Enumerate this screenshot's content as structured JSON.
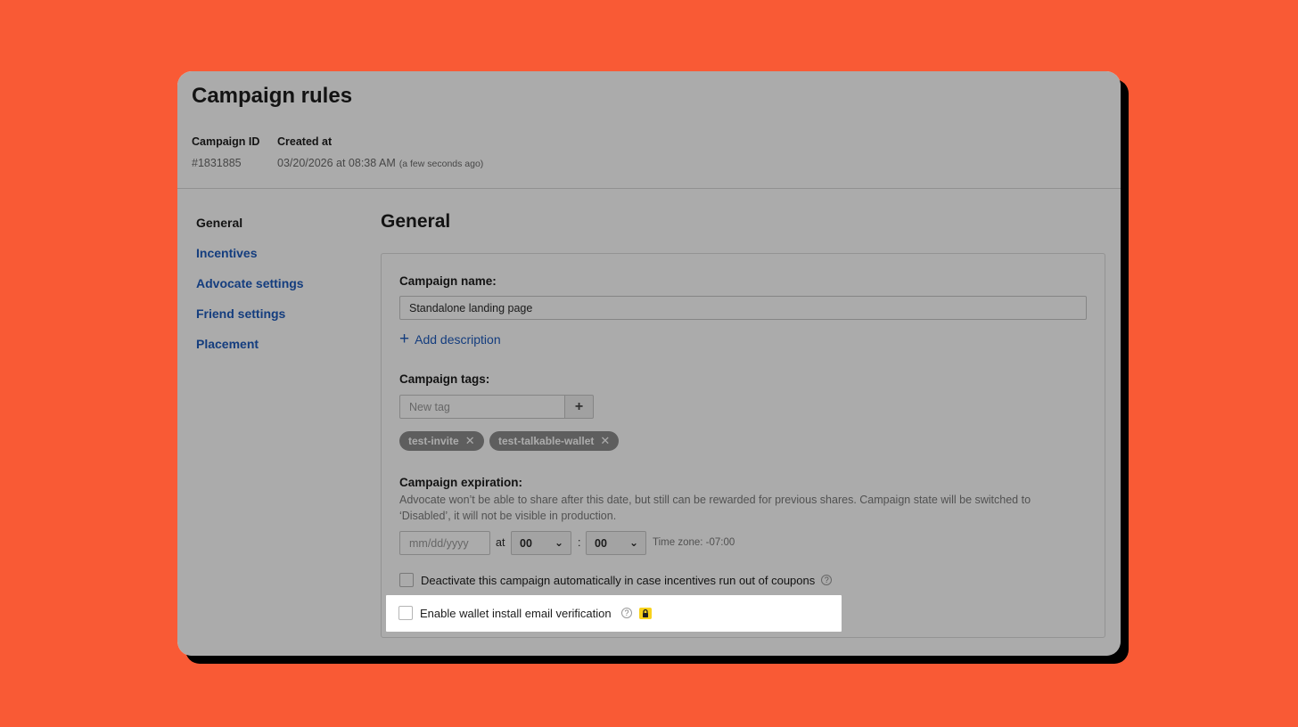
{
  "page": {
    "title": "Campaign rules"
  },
  "meta": {
    "campaign_id_label": "Campaign ID",
    "campaign_id_value": "#1831885",
    "created_at_label": "Created at",
    "created_at_value": "03/20/2026 at 08:38 AM",
    "created_at_relative": "(a few seconds ago)"
  },
  "sidebar": {
    "items": [
      {
        "label": "General",
        "active": true
      },
      {
        "label": "Incentives"
      },
      {
        "label": "Advocate settings"
      },
      {
        "label": "Friend settings"
      },
      {
        "label": "Placement"
      }
    ]
  },
  "general": {
    "title": "General",
    "campaign_name_label": "Campaign name:",
    "campaign_name_value": "Standalone landing page",
    "add_description": "Add description",
    "tags_label": "Campaign tags:",
    "new_tag_placeholder": "New tag",
    "add_tag_symbol": "+",
    "tags": [
      "test-invite",
      "test-talkable-wallet"
    ],
    "expiration_label": "Campaign expiration:",
    "expiration_help": "Advocate won’t be able to share after this date, but still can be rewarded for previous shares. Campaign state will be switched to ‘Disabled’, it will not be visible in production.",
    "date_placeholder": "mm/dd/yyyy",
    "at_text": "at",
    "hour_value": "00",
    "colon": ":",
    "minute_value": "00",
    "timezone": "Time zone: -07:00",
    "deactivate_label": "Deactivate this campaign automatically in case incentives run out of coupons",
    "wallet_label": "Enable wallet install email verification"
  },
  "icons": {
    "help": "question-circle-icon",
    "lock": "lock-icon",
    "plus": "plus-icon",
    "close": "close-icon",
    "chevron": "chevron-down-icon"
  },
  "colors": {
    "background": "#f95a35",
    "link": "#1e5bbd",
    "lock_badge": "#f8d21c"
  }
}
